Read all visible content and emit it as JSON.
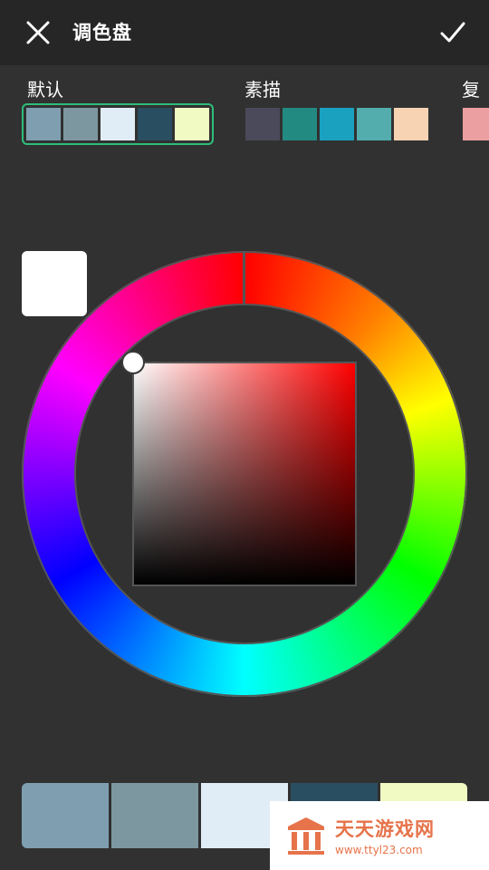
{
  "header": {
    "title": "调色盘",
    "close_icon": "close-icon",
    "confirm_icon": "check-icon"
  },
  "palettes": [
    {
      "label": "默认",
      "selected": true,
      "colors": [
        "#7f9fb1",
        "#7d97a1",
        "#e1edf6",
        "#2a4e61",
        "#f0fac2"
      ]
    },
    {
      "label": "素描",
      "selected": false,
      "colors": [
        "#4a4a5a",
        "#238a82",
        "#1aa1c0",
        "#53adad",
        "#f7d3b4"
      ]
    },
    {
      "label": "复",
      "selected": false,
      "colors": [
        "#ec9fa1"
      ]
    }
  ],
  "current_color": "#ffffff",
  "hue_color": "#ff0000",
  "bottom_swatches": [
    "#7f9fb1",
    "#7d97a1",
    "#e1edf6",
    "#2a4e61",
    "#f0fac2"
  ],
  "watermark": {
    "name": "天天游戏网",
    "url": "www.ttyl23.com"
  },
  "colors": {
    "topbar": "#262626",
    "background": "#313131",
    "selected_border": "#2ebd7a",
    "watermark_accent": "#e6734a"
  }
}
